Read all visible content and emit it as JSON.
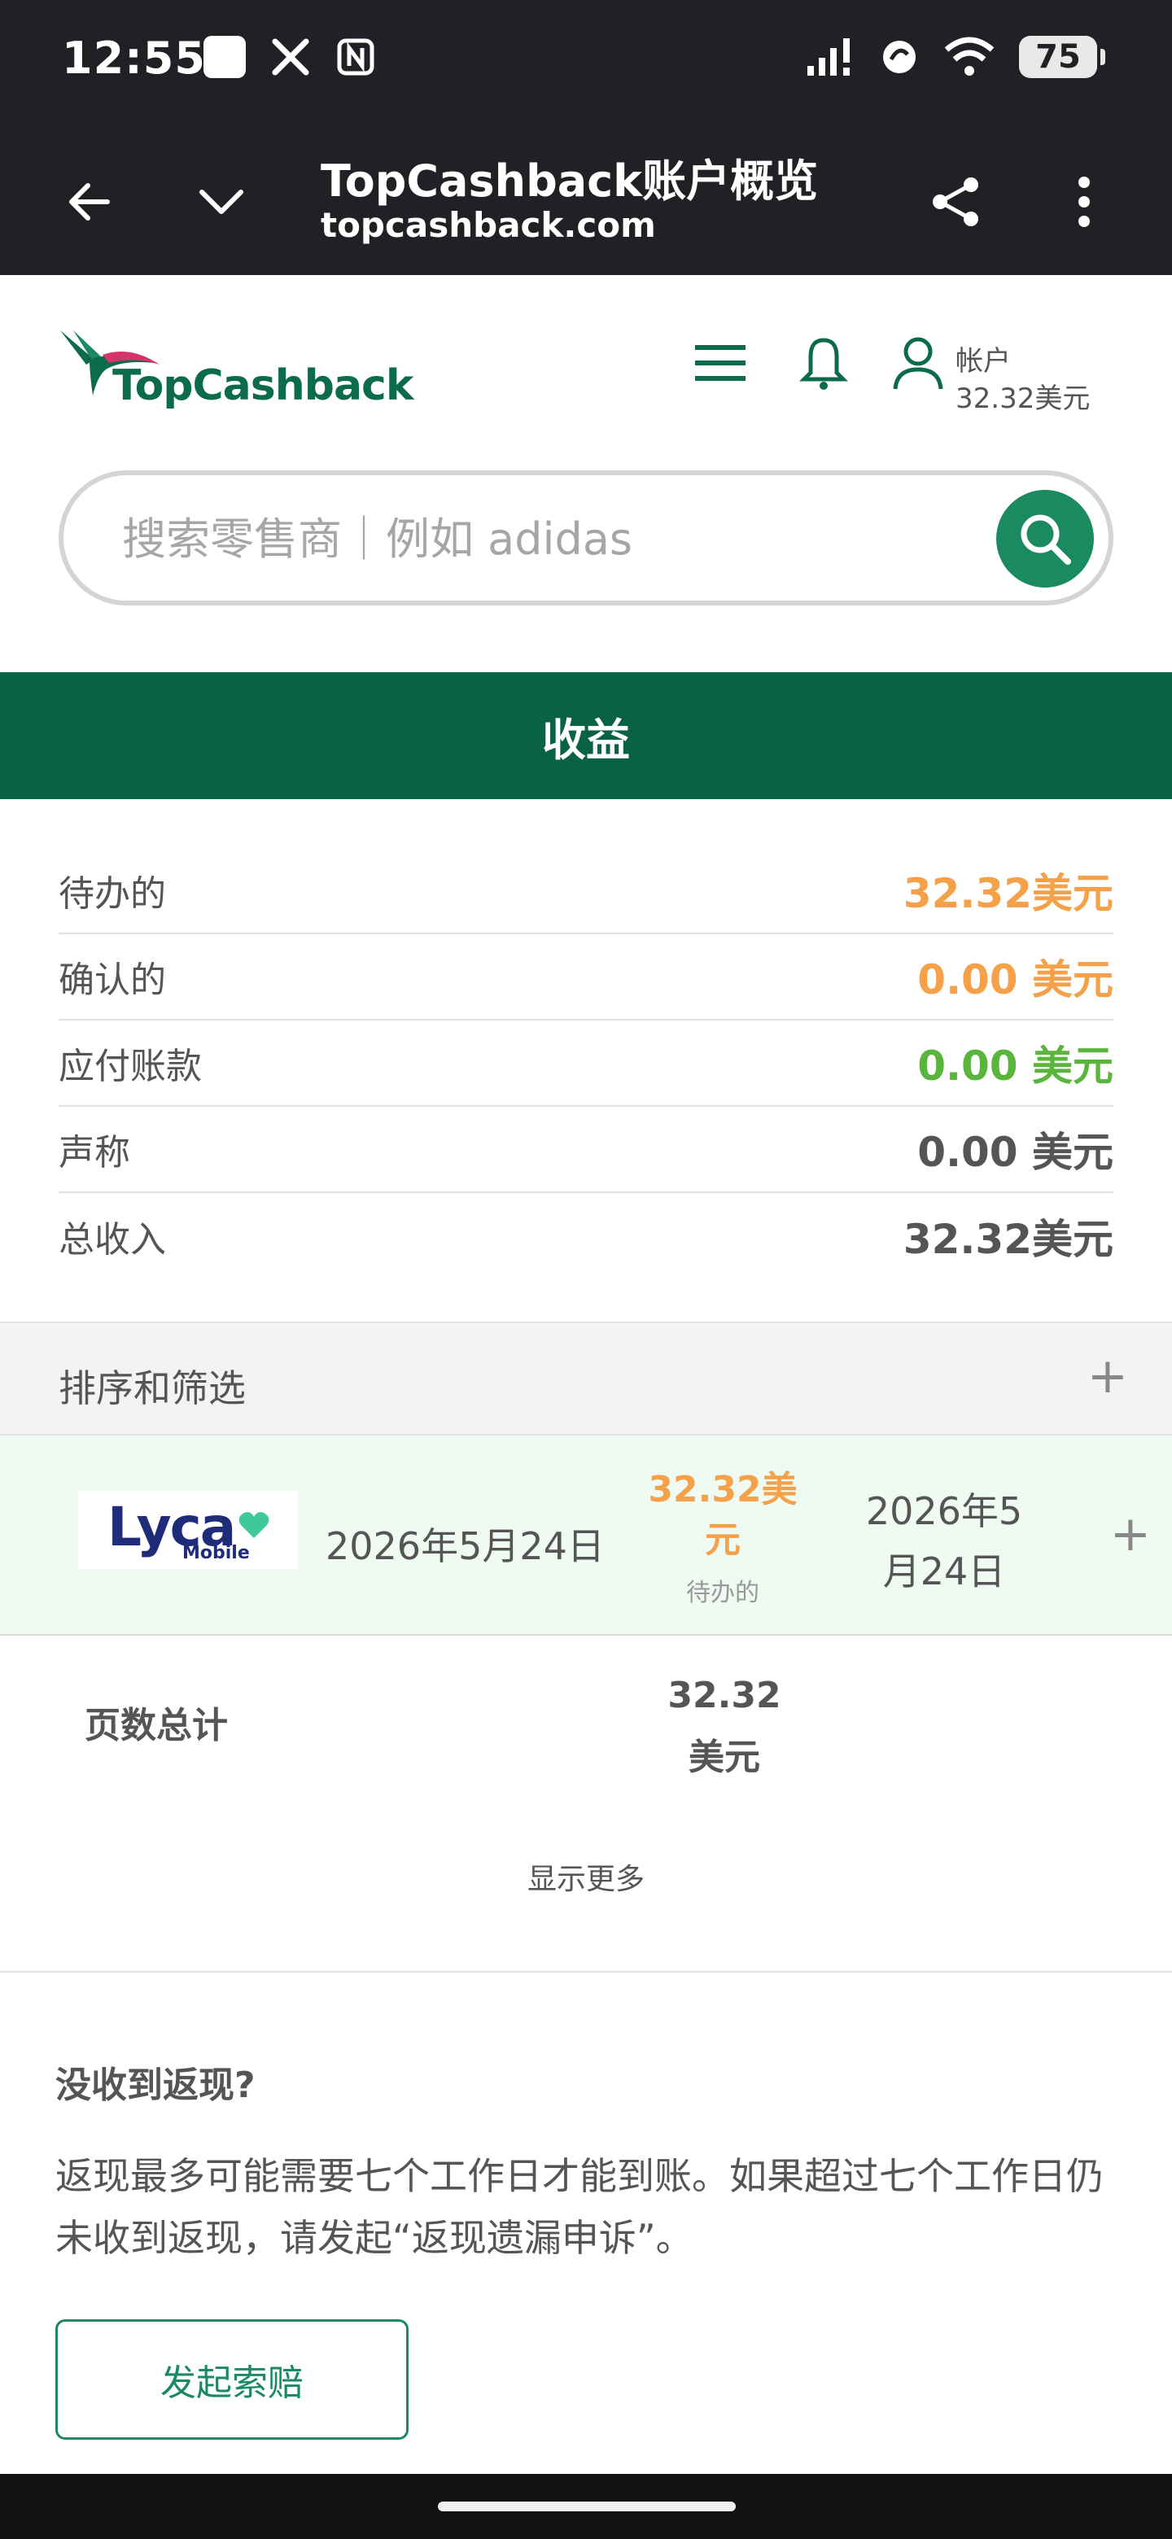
{
  "status_bar": {
    "time": "12:55",
    "battery": "75",
    "icons": [
      "square-notification-icon",
      "x-icon",
      "nfc-icon",
      "signal-icon",
      "vpn-icon",
      "wifi-icon",
      "battery-icon"
    ]
  },
  "browser": {
    "title": "TopCashback账户概览",
    "url": "topcashback.com"
  },
  "header": {
    "logo_text": "TopCashback",
    "account_label": "帐户",
    "account_value": "32.32美元"
  },
  "search": {
    "placeholder": "搜索零售商｜例如 adidas"
  },
  "banner": {
    "title": "收益"
  },
  "summary": [
    {
      "label": "待办的",
      "value": "32.32美元",
      "color": "#f5a14a"
    },
    {
      "label": "确认的",
      "value": "0.00 美元",
      "color": "#f5a14a"
    },
    {
      "label": "应付账款",
      "value": "0.00 美元",
      "color": "#5ab53c"
    },
    {
      "label": "声称",
      "value": "0.00 美元",
      "color": "#555555"
    },
    {
      "label": "总收入",
      "value": "32.32美元",
      "color": "#555555"
    }
  ],
  "sort_filter": {
    "label": "排序和筛选",
    "toggle": "+"
  },
  "transaction": {
    "merchant_logo": "Lyca",
    "merchant_logo_sub": "Mobile",
    "date": "2026年5月24日",
    "amount_line1": "32.32美",
    "amount_line2": "元",
    "status": "待办的",
    "date2_line1": "2026年5",
    "date2_line2": "月24日",
    "toggle": "+"
  },
  "page_total": {
    "label": "页数总计",
    "value_line1": "32.32",
    "value_line2": "美元"
  },
  "show_more": "显示更多",
  "claim": {
    "title": "没收到返现?",
    "text": "返现最多可能需要七个工作日才能到账。如果超过七个工作日仍未收到返现，请发起“返现遗漏申诉”。",
    "button": "发起索赔"
  },
  "colors": {
    "brand_green": "#0a6244",
    "accent_green": "#1a8a60",
    "pending_orange": "#f5a14a",
    "payable_green": "#5ab53c"
  }
}
